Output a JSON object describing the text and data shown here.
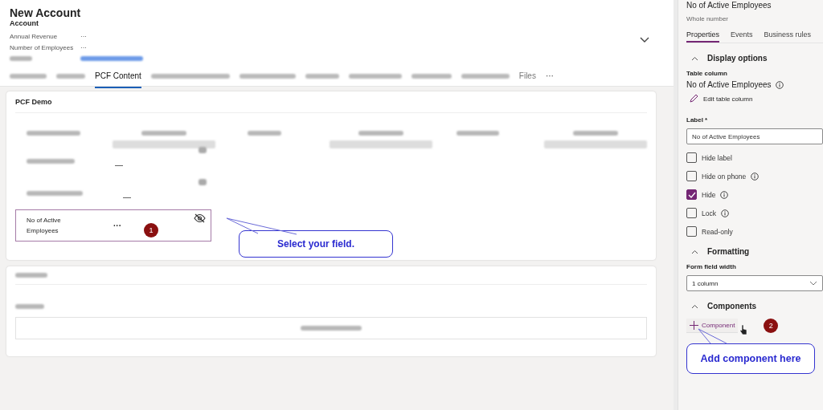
{
  "header": {
    "title": "New Account",
    "subtitle": "Account",
    "fields": [
      {
        "kind": "text",
        "label": "Annual Revenue",
        "value": "···"
      },
      {
        "kind": "text",
        "label": "Number of Employees",
        "value": "···"
      },
      {
        "kind": "redacted"
      }
    ]
  },
  "tabs": [
    {
      "kind": "redacted",
      "selected": false
    },
    {
      "kind": "redacted",
      "selected": false
    },
    {
      "kind": "text",
      "label": "PCF Content",
      "selected": true
    },
    {
      "kind": "redacted",
      "selected": false
    },
    {
      "kind": "redacted",
      "selected": false
    },
    {
      "kind": "redacted",
      "selected": false
    },
    {
      "kind": "redacted",
      "selected": false
    },
    {
      "kind": "redacted",
      "selected": false
    },
    {
      "kind": "redacted",
      "selected": false
    },
    {
      "kind": "text",
      "label": "Files",
      "selected": false
    },
    {
      "kind": "more",
      "label": "···",
      "selected": false
    }
  ],
  "pcf_card": {
    "title": "PCF Demo",
    "selected_field": {
      "label": "No of Active Employees",
      "value": "···",
      "hidden": true,
      "step": "1"
    },
    "callout": "Select your field."
  },
  "panel": {
    "title": "No of Active Employees",
    "subtitle": "Whole number",
    "tabs": [
      {
        "label": "Properties",
        "selected": true
      },
      {
        "label": "Events",
        "selected": false
      },
      {
        "label": "Business rules",
        "selected": false
      }
    ],
    "display": {
      "heading": "Display options",
      "expanded": true,
      "column_label": "Table column",
      "column_name": "No of Active Employees",
      "edit_link": "Edit table column",
      "label_caption": "Label *",
      "label_value": "No of Active Employees",
      "checkboxes": [
        {
          "label": "Hide label",
          "checked": false,
          "info": false
        },
        {
          "label": "Hide on phone",
          "checked": false,
          "info": true
        },
        {
          "label": "Hide",
          "checked": true,
          "info": true
        },
        {
          "label": "Lock",
          "checked": false,
          "info": true
        },
        {
          "label": "Read-only",
          "checked": false,
          "info": false
        }
      ]
    },
    "formatting": {
      "heading": "Formatting",
      "expanded": true,
      "width_label": "Form field width",
      "width_value": "1 column"
    },
    "components": {
      "heading": "Components",
      "expanded": true,
      "add_label": "Component",
      "step": "2",
      "callout": "Add component here"
    }
  }
}
